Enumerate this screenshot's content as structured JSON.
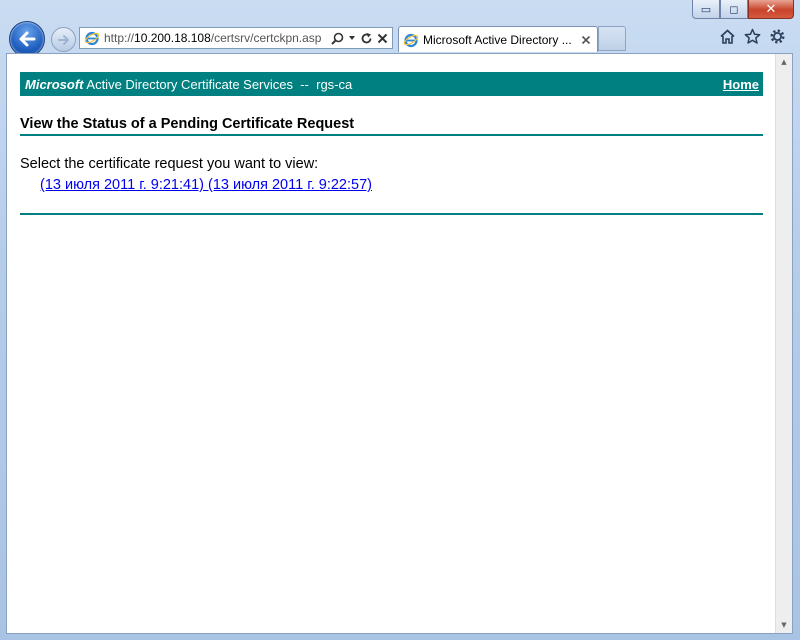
{
  "browser": {
    "address_url_prefix": "http://",
    "address_url_host": "10.200.18.108",
    "address_url_path": "/certsrv/certckpn.asp",
    "tab_title": "Microsoft Active Directory ...",
    "caption_minimize": "▭",
    "caption_maximize": "◻",
    "caption_close": "✕",
    "icons": [
      "back-arrow-icon",
      "forward-arrow-icon",
      "ie-logo-icon",
      "search-icon",
      "dropdown-icon",
      "refresh-icon",
      "stop-icon",
      "tab-close-icon",
      "home-icon",
      "favorites-star-icon",
      "gear-icon"
    ]
  },
  "page": {
    "banner_brand": "Microsoft",
    "banner_service": " Active Directory Certificate Services  --  rgs-ca",
    "home_label": "Home",
    "heading": "View the Status of a Pending Certificate Request",
    "prompt": "Select the certificate request you want to view:",
    "requests": [
      "(13 июля 2011 г. 9:21:41) (13 июля 2011 г. 9:22:57)"
    ]
  },
  "colors": {
    "banner": "#008080",
    "link": "#0000ee"
  }
}
